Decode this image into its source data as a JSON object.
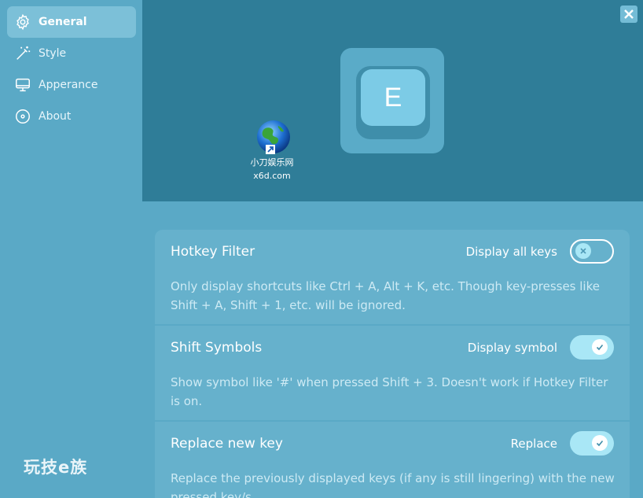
{
  "sidebar": {
    "items": [
      {
        "label": "General",
        "icon": "gear-icon",
        "active": true
      },
      {
        "label": "Style",
        "icon": "magic-wand-icon",
        "active": false
      },
      {
        "label": "Apperance",
        "icon": "monitor-icon",
        "active": false
      },
      {
        "label": "About",
        "icon": "info-circle-icon",
        "active": false
      }
    ],
    "brand": "玩技e族"
  },
  "preview": {
    "key_label": "E",
    "desktop_icon": {
      "name": "小刀娱乐网",
      "domain": "x6d.com"
    }
  },
  "settings": [
    {
      "title": "Hotkey Filter",
      "action_label": "Display all keys",
      "enabled": false,
      "description": "Only display shortcuts like Ctrl + A, Alt + K, etc. Though key-presses like Shift + A, Shift + 1, etc. will be ignored."
    },
    {
      "title": "Shift Symbols",
      "action_label": "Display symbol",
      "enabled": true,
      "description": "Show symbol like '#' when pressed Shift + 3. Doesn't work if Hotkey Filter is on."
    },
    {
      "title": "Replace new key",
      "action_label": "Replace",
      "enabled": true,
      "description": "Replace the previously displayed keys (if any is still lingering) with the new pressed key/s."
    }
  ],
  "colors": {
    "sidebar_bg": "#5aa9c6",
    "preview_bg": "#2f7d98",
    "card_bg": "#66b1cc",
    "toggle_on": "#a9e7f6"
  }
}
